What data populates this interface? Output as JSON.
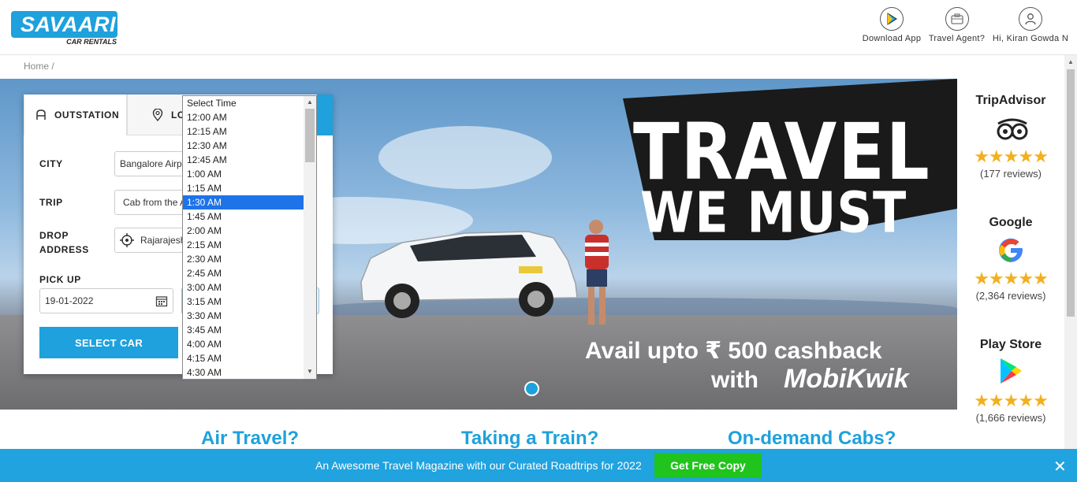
{
  "header": {
    "logo_text": "SAVAARI",
    "logo_sub": "CAR RENTALS",
    "download_app": "Download App",
    "travel_agent": "Travel Agent?",
    "user_greeting": "Hi, Kiran Gowda N"
  },
  "breadcrumb": "Home /",
  "hero": {
    "line1": "TRAVEL",
    "line2": "WE MUST",
    "promo_line1": "Avail upto ₹ 500 cashback",
    "promo_line2": "with",
    "promo_brand": "MobiKwik"
  },
  "booking": {
    "tabs": {
      "outstation": "OUTSTATION",
      "local": "LO"
    },
    "city_label": "CITY",
    "city_value": "Bangalore Airp",
    "trip_label": "TRIP",
    "trip_value": "Cab from the A",
    "drop_label_1": "DROP",
    "drop_label_2": "ADDRESS",
    "drop_value": "Rajarajesh",
    "pickup_label": "PICK UP",
    "pickup_date": "19-01-2022",
    "select_car": "SELECT CAR"
  },
  "time_dropdown": {
    "options": [
      "Select Time",
      "12:00 AM",
      "12:15 AM",
      "12:30 AM",
      "12:45 AM",
      "1:00 AM",
      "1:15 AM",
      "1:30 AM",
      "1:45 AM",
      "2:00 AM",
      "2:15 AM",
      "2:30 AM",
      "2:45 AM",
      "3:00 AM",
      "3:15 AM",
      "3:30 AM",
      "3:45 AM",
      "4:00 AM",
      "4:15 AM",
      "4:30 AM"
    ],
    "selected": "1:30 AM"
  },
  "ratings": [
    {
      "name": "TripAdvisor",
      "stars": "★★★★★",
      "rating_fraction": 1.0,
      "reviews": "(177 reviews)",
      "icon": "tripadvisor-owl-icon"
    },
    {
      "name": "Google",
      "stars": "★★★★★",
      "rating_fraction": 0.9,
      "reviews": "(2,364 reviews)",
      "icon": "google-g-icon"
    },
    {
      "name": "Play Store",
      "stars": "★★★★★",
      "rating_fraction": 0.9,
      "reviews": "(1,666 reviews)",
      "icon": "play-store-icon"
    }
  ],
  "features": {
    "air": "Air Travel?",
    "train": "Taking a Train?",
    "cabs": "On-demand Cabs?"
  },
  "footer": {
    "text": "An Awesome Travel Magazine with our Curated Roadtrips for 2022",
    "cta": "Get Free Copy",
    "close": "✕"
  },
  "colors": {
    "brand_blue": "#1ea1dc",
    "footer_blue": "#20a3df",
    "cta_green": "#21c41d",
    "star_gold": "#f2b01e",
    "selected_option": "#1e73e8"
  }
}
